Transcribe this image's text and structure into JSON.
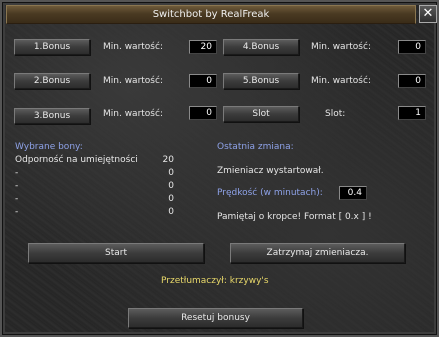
{
  "window": {
    "title": "Switchbot by RealFreak",
    "close_glyph": "✕"
  },
  "bonus_rows": [
    {
      "button": "1.Bonus",
      "label": "Min. wartość:",
      "value": "20"
    },
    {
      "button": "4.Bonus",
      "label": "Min. wartość:",
      "value": "0"
    },
    {
      "button": "2.Bonus",
      "label": "Min. wartość:",
      "value": "0"
    },
    {
      "button": "5.Bonus",
      "label": "Min. wartość:",
      "value": "0"
    },
    {
      "button": "3.Bonus",
      "label": "Min. wartość:",
      "value": "0"
    }
  ],
  "slot": {
    "button": "Slot",
    "label": "Slot:",
    "value": "1"
  },
  "selected_bonuses": {
    "title": "Wybrane bony:",
    "rows": [
      {
        "name": "Odporność na umiejętności",
        "value": "20"
      },
      {
        "name": "-",
        "value": "0"
      },
      {
        "name": "-",
        "value": "0"
      },
      {
        "name": "-",
        "value": "0"
      },
      {
        "name": "-",
        "value": "0"
      }
    ]
  },
  "last_change": {
    "title": "Ostatnia zmiana:",
    "status": "Zmieniacz wystartował.",
    "speed_label": "Prędkość (w minutach):",
    "speed_value": "0.4",
    "hint": "Pamiętaj o kropce! Format [ 0.x ] !"
  },
  "actions": {
    "start": "Start",
    "stop": "Zatrzymaj zmieniacza.",
    "reset": "Resetuj bonusy"
  },
  "translator": "Przetłumaczył: krzywy's",
  "colors": {
    "section_title": "#8ea2e8",
    "translator": "#e8d86a",
    "titlebar": "#4a3a22"
  }
}
